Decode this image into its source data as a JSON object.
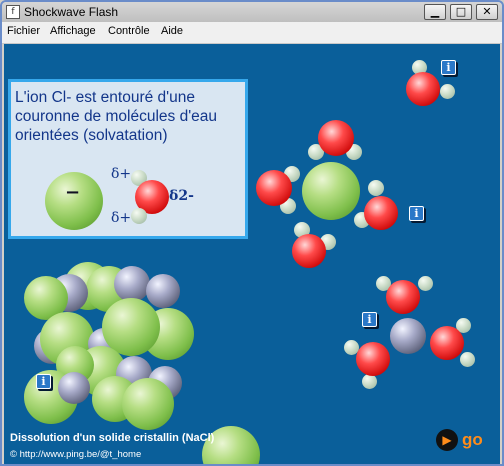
{
  "window": {
    "title": "Shockwave Flash",
    "app_icon": "flash-player-icon",
    "controls": {
      "minimize": "▁",
      "maximize": "□",
      "close": "✕"
    }
  },
  "menu": {
    "items": [
      "Fichier",
      "Affichage",
      "Contrôle",
      "Aide"
    ]
  },
  "panel": {
    "text": "L'ion Cl- est entouré d'une couronne de molécules d'eau orientées (solvatation)",
    "ion_sign": "−",
    "delta_plus_top": "δ+",
    "delta_plus_bottom": "δ+",
    "delta_minus": "δ2-"
  },
  "info_icon_symbol": "i",
  "footer": {
    "caption": "Dissolution d'un solide cristallin (NaCl)",
    "url": "© http://www.ping.be/@t_home",
    "go_label": "go",
    "go_icon_symbol": "▶"
  },
  "colors": {
    "stage_background": "#0a5f9a",
    "panel_background": "#d9e6f2",
    "panel_border": "#36a8ec",
    "chloride": "#7fbf4b",
    "sodium": "#62667f",
    "oxygen": "#d10c0c",
    "hydrogen": "#cbdcc8",
    "go_accent": "#ff8c1a"
  }
}
